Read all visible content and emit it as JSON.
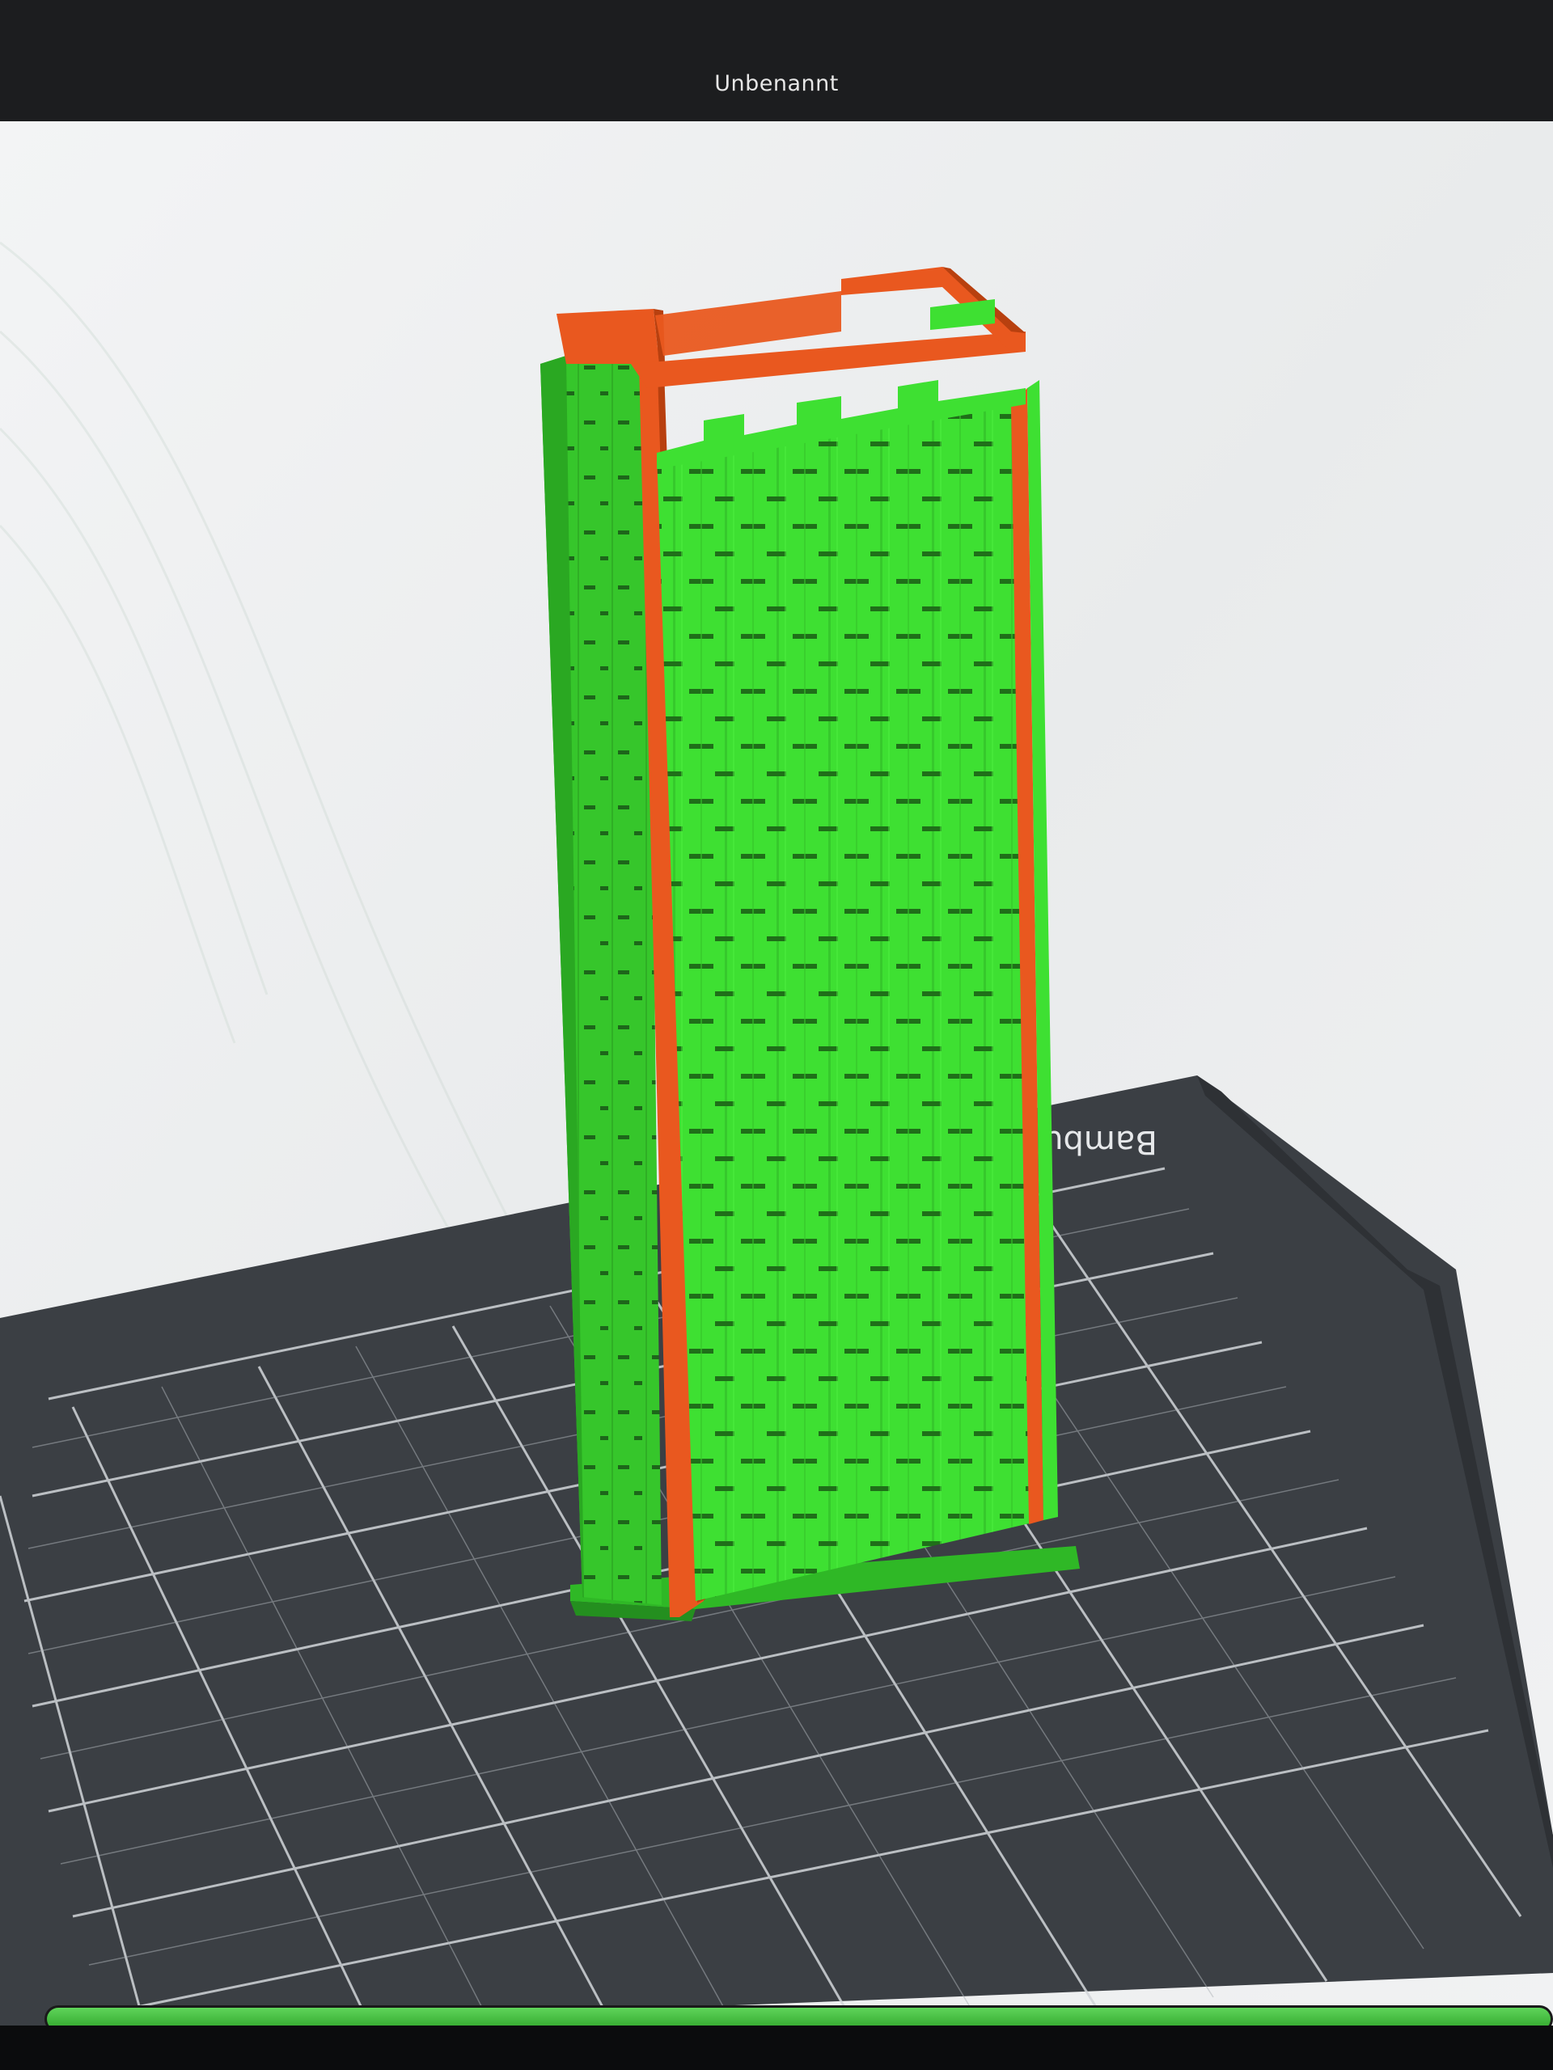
{
  "window": {
    "title": "Unbenannt"
  },
  "build_plate": {
    "brand_text": "Bambu"
  },
  "model": {
    "description_colors": {
      "wall": "#3ee032",
      "wall_shadow": "#2bb423",
      "edge": "#e9581f",
      "edge_dark": "#b8400f",
      "bed": "#3b3f44",
      "grid": "#d2d6da",
      "background": "#eceef0"
    }
  },
  "progress": {
    "value_percent": 100
  }
}
